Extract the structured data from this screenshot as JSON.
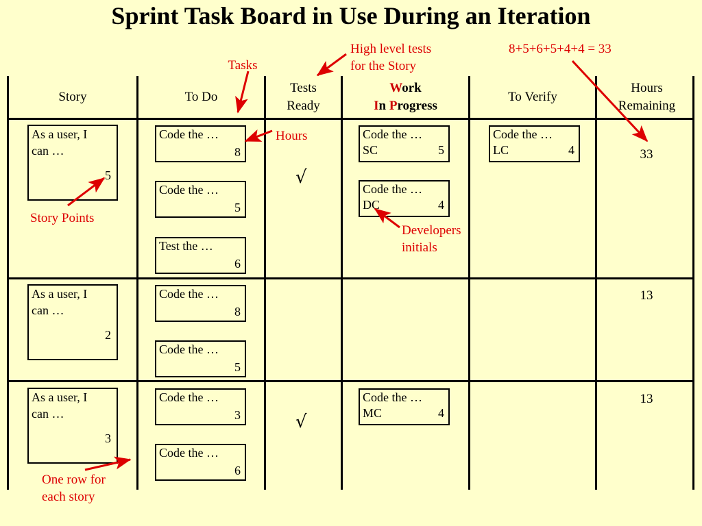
{
  "title": "Sprint Task Board in Use During an Iteration",
  "colors": {
    "background": "#ffffcc",
    "grid": "#000000",
    "annotation": "#dd0000",
    "text": "#000000"
  },
  "board": {
    "columns": [
      {
        "id": "story",
        "line1": "Story",
        "line2": ""
      },
      {
        "id": "to-do",
        "line1": "To Do",
        "line2": ""
      },
      {
        "id": "tests-ready",
        "line1": "Tests",
        "line2": "Ready"
      },
      {
        "id": "work-in-progress",
        "line1": "Work",
        "line2": "In Progress",
        "highlight": [
          "W",
          "I",
          "P"
        ]
      },
      {
        "id": "to-verify",
        "line1": "To Verify",
        "line2": ""
      },
      {
        "id": "hours-remaining",
        "line1": "Hours",
        "line2": "Remaining"
      }
    ],
    "rows": [
      {
        "story": {
          "line1": "As a user, I",
          "line2": "can …",
          "points": "5"
        },
        "to_do": [
          {
            "title": "Code the …",
            "hours": "8"
          },
          {
            "title": "Code the …",
            "hours": "5"
          },
          {
            "title": "Test the …",
            "hours": "6"
          }
        ],
        "tests_ready": "√",
        "work_in_progress": [
          {
            "title": "Code the …",
            "initials": "SC",
            "hours": "5"
          },
          {
            "title": "Code the …",
            "initials": "DC",
            "hours": "4"
          }
        ],
        "to_verify": [
          {
            "title": "Code the …",
            "initials": "LC",
            "hours": "4"
          }
        ],
        "hours_remaining": "33"
      },
      {
        "story": {
          "line1": "As a user, I",
          "line2": "can …",
          "points": "2"
        },
        "to_do": [
          {
            "title": "Code the …",
            "hours": "8"
          },
          {
            "title": "Code the …",
            "hours": "5"
          }
        ],
        "tests_ready": "",
        "work_in_progress": [],
        "to_verify": [],
        "hours_remaining": "13"
      },
      {
        "story": {
          "line1": "As a user, I",
          "line2": "can …",
          "points": "3"
        },
        "to_do": [
          {
            "title": "Code the …",
            "hours": "3"
          },
          {
            "title": "Code the …",
            "hours": "6"
          }
        ],
        "tests_ready": "√",
        "work_in_progress": [
          {
            "title": "Code the …",
            "initials": "MC",
            "hours": "4"
          }
        ],
        "to_verify": [],
        "hours_remaining": "13"
      }
    ]
  },
  "annotations": {
    "tasks": "Tasks",
    "high_level_tests": "High level tests\nfor the Story",
    "sum_formula": "8+5+6+5+4+4 = 33",
    "hours": "Hours",
    "story_points": "Story Points",
    "developers_initials": "Developers\ninitials",
    "one_row_per_story": "One row for\neach story"
  }
}
